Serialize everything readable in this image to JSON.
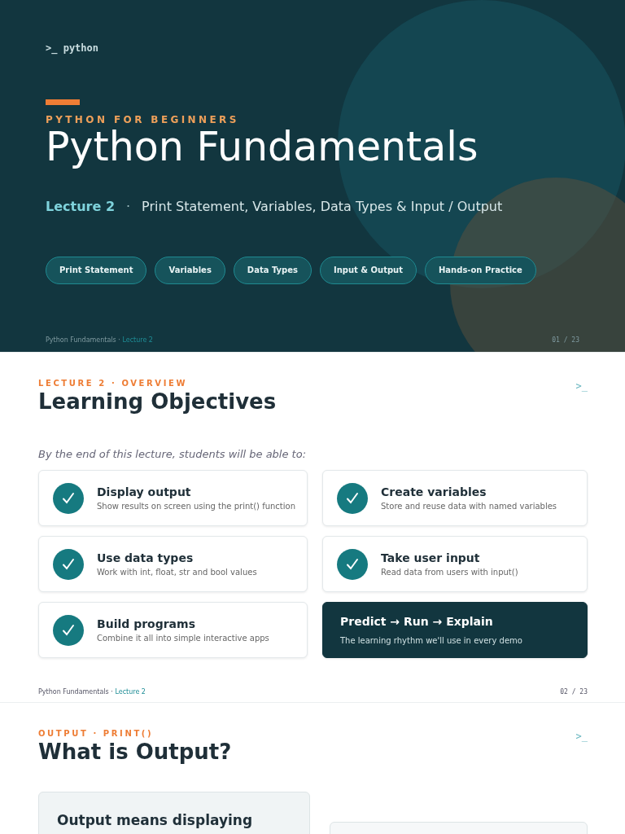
{
  "slides": [
    {
      "kind": "title",
      "brand": ">_ python",
      "eyebrow": "PYTHON FOR BEGINNERS",
      "title": "Python Fundamentals",
      "lecture": "Lecture 2",
      "separator": "·",
      "subtitle": "Print Statement, Variables, Data Types & Input / Output",
      "topics": [
        "Print Statement",
        "Variables",
        "Data Types",
        "Input & Output",
        "Hands-on Practice"
      ],
      "footer": {
        "deck": "Python Fundamentals",
        "sep": "·",
        "lecture": "Lecture 2",
        "page": "01 / 23"
      }
    },
    {
      "kind": "objectives",
      "prompt": ">_",
      "eyebrow": "LECTURE 2 · OVERVIEW",
      "title": "Learning Objectives",
      "intro": "By the end of this lecture, students will be able to:",
      "cards": [
        {
          "kind": "check",
          "title": "Display output",
          "text": "Show results on screen using the print() function"
        },
        {
          "kind": "check",
          "title": "Create variables",
          "text": "Store and reuse data with named variables"
        },
        {
          "kind": "check",
          "title": "Use data types",
          "text": "Work with int, float, str and bool values"
        },
        {
          "kind": "check",
          "title": "Take user input",
          "text": "Read data from users with input()"
        },
        {
          "kind": "check",
          "title": "Build programs",
          "text": "Combine it all into simple interactive apps"
        },
        {
          "kind": "highlight",
          "title": "Predict → Run → Explain",
          "text": "The learning rhythm we'll use in every demo"
        }
      ],
      "footer": {
        "deck": "Python Fundamentals",
        "sep": "·",
        "lecture": "Lecture 2",
        "page": "02 / 23"
      }
    },
    {
      "kind": "content",
      "prompt": ">_",
      "eyebrow": "OUTPUT · PRINT()",
      "title": "What is Output?",
      "card_text": "Output means displaying"
    }
  ]
}
